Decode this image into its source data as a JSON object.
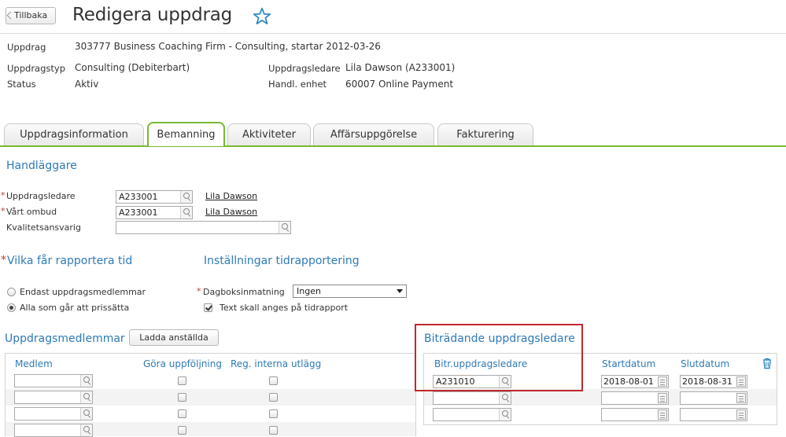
{
  "header": {
    "back_label": "Tillbaka",
    "title": "Redigera uppdrag"
  },
  "info": {
    "uppdrag_label": "Uppdrag",
    "uppdrag_value": "303777 Business Coaching Firm - Consulting, startar 2012-03-26",
    "typ_label": "Uppdragstyp",
    "typ_value": "Consulting (Debiterbart)",
    "status_label": "Status",
    "status_value": "Aktiv",
    "ledare_label": "Uppdragsledare",
    "ledare_value": "Lila Dawson (A233001)",
    "enhet_label": "Handl. enhet",
    "enhet_value": "60007 Online Payment"
  },
  "tabs": [
    {
      "label": "Uppdragsinformation"
    },
    {
      "label": "Bemanning",
      "active": true
    },
    {
      "label": "Aktiviteter"
    },
    {
      "label": "Affärsuppgörelse"
    },
    {
      "label": "Fakturering"
    }
  ],
  "handlaggare": {
    "title": "Handläggare",
    "required_mark": "*",
    "uppdragsledare_label": "Uppdragsledare",
    "uppdragsledare_value": "A233001",
    "uppdragsledare_name": "Lila Dawson",
    "ombud_label": "Vårt ombud",
    "ombud_value": "A233001",
    "ombud_name": "Lila Dawson",
    "kvalitet_label": "Kvalitetsansvarig",
    "kvalitet_value": ""
  },
  "rapportera": {
    "title": "Vilka får rapportera tid",
    "option1": "Endast uppdragsmedlemmar",
    "option2": "Alla som går att prissätta",
    "selected": 2
  },
  "installningar": {
    "title": "Inställningar tidrapportering",
    "dagbok_label": "Dagboksinmatning",
    "dagbok_value": "Ingen",
    "text_label": "Text skall anges på tidrapport",
    "text_checked": true
  },
  "medlemmar": {
    "title": "Uppdragsmedlemmar",
    "load_button": "Ladda anställda",
    "columns": [
      "Medlem",
      "Göra uppföljning",
      "Reg. interna utlägg"
    ],
    "rows": 4
  },
  "bitradande": {
    "title": "Biträdande uppdragsledare",
    "columns": [
      "Bitr.uppdragsledare",
      "Startdatum",
      "Slutdatum"
    ],
    "rows": [
      {
        "ledare": "A231010",
        "start": "2018-08-01",
        "slut": "2018-08-31"
      },
      {
        "ledare": "",
        "start": "",
        "slut": ""
      },
      {
        "ledare": "",
        "start": "",
        "slut": ""
      }
    ]
  },
  "colors": {
    "accent_green": "#78b837",
    "section_blue": "#2e7ab8",
    "highlight_red": "#c0282d",
    "star_blue": "#2e86c1"
  },
  "icons": [
    "star-icon",
    "search-icon",
    "calendar-icon",
    "trash-icon"
  ]
}
